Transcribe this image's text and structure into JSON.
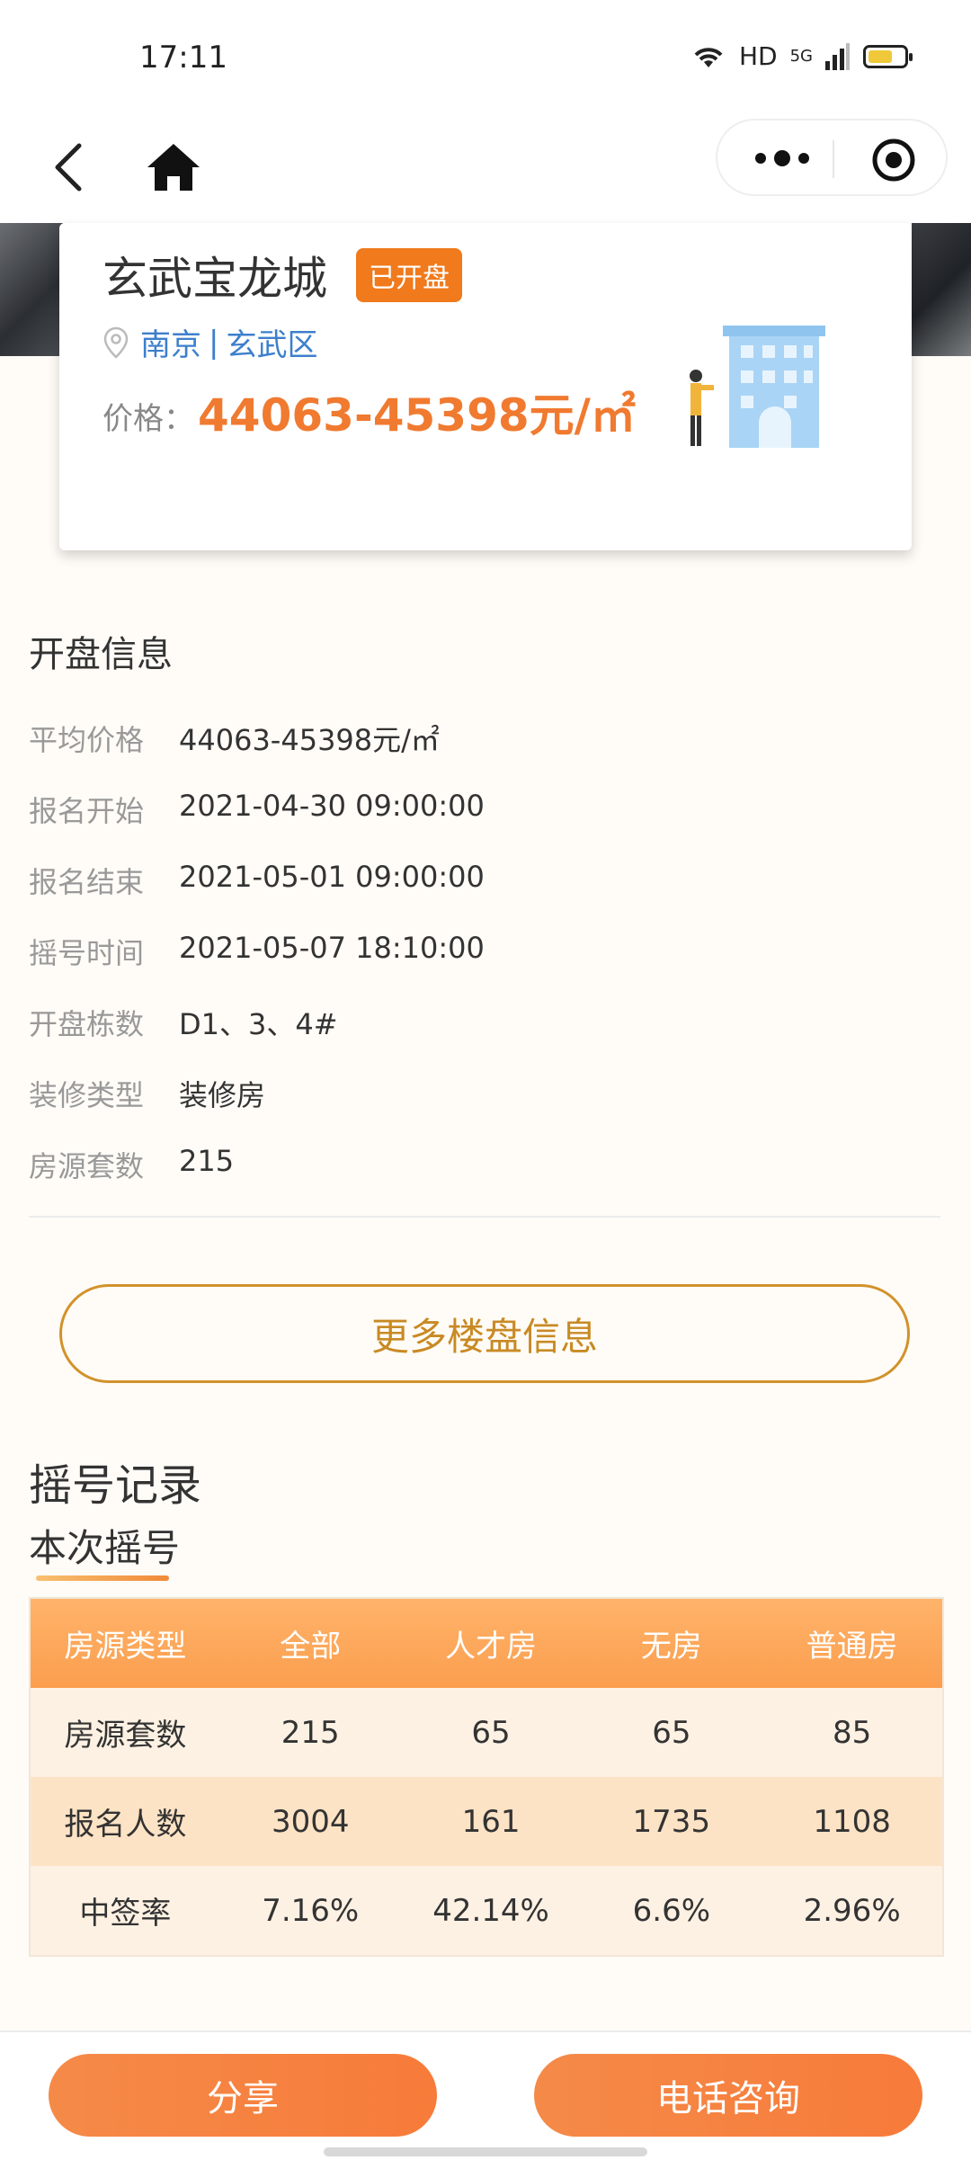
{
  "status_bar": {
    "time": "17:11",
    "hd": "HD",
    "network": "5G"
  },
  "project": {
    "name": "玄武宝龙城",
    "badge": "已开盘",
    "city": "南京",
    "separator": "|",
    "district": "玄武区",
    "price_label": "价格：",
    "price_value": "44063-45398元/㎡"
  },
  "opening_info": {
    "title": "开盘信息",
    "rows": [
      {
        "label": "平均价格",
        "value": "44063-45398元/㎡"
      },
      {
        "label": "报名开始",
        "value": "2021-04-30 09:00:00"
      },
      {
        "label": "报名结束",
        "value": "2021-05-01 09:00:00"
      },
      {
        "label": "摇号时间",
        "value": "2021-05-07 18:10:00"
      },
      {
        "label": "开盘栋数",
        "value": "D1、3、4#"
      },
      {
        "label": "装修类型",
        "value": "装修房"
      },
      {
        "label": "房源套数",
        "value": "215"
      }
    ]
  },
  "more_button": "更多楼盘信息",
  "lottery": {
    "title": "摇号记录",
    "tab": "本次摇号",
    "table": {
      "headers": [
        "房源类型",
        "全部",
        "人才房",
        "无房",
        "普通房"
      ],
      "rows": [
        [
          "房源套数",
          "215",
          "65",
          "65",
          "85"
        ],
        [
          "报名人数",
          "3004",
          "161",
          "1735",
          "1108"
        ],
        [
          "中签率",
          "7.16%",
          "42.14%",
          "6.6%",
          "2.96%"
        ]
      ]
    }
  },
  "bottom": {
    "share": "分享",
    "call": "电话咨询"
  },
  "colors": {
    "accent": "#f07a30",
    "gold": "#c88a24",
    "link": "#3d7fcc"
  }
}
